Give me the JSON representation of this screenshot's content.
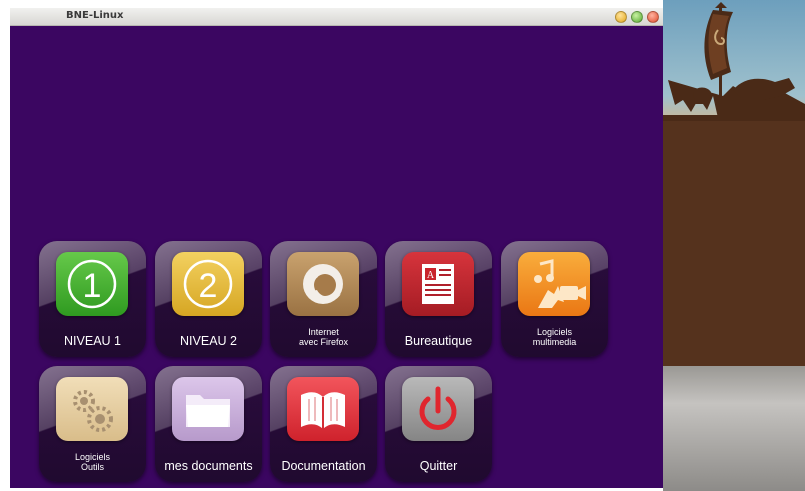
{
  "window": {
    "title": "BNE-Linux"
  },
  "colors": {
    "window_bg": "#3b0661",
    "niveau1": "#3fae2a",
    "niveau2": "#e3b72a",
    "internet": "#b28a58",
    "bureautique": "#b0202a",
    "multimedia": "#f08a20",
    "outils": "#e7cfa2",
    "documents": "#c9b0d9",
    "documentation": "#e8323c",
    "quitter": "#9a9a9a"
  },
  "tiles": [
    {
      "id": "niveau-1",
      "icon": "number-one-icon",
      "label": "NIVEAU 1"
    },
    {
      "id": "niveau-2",
      "icon": "number-two-icon",
      "label": "NIVEAU 2"
    },
    {
      "id": "internet",
      "icon": "firefox-icon",
      "label_line1": "Internet",
      "label_line2": "avec Firefox"
    },
    {
      "id": "bureautique",
      "icon": "document-icon",
      "label": "Bureautique"
    },
    {
      "id": "multimedia",
      "icon": "multimedia-icon",
      "label_line1": "Logiciels",
      "label_line2": "multimedia"
    },
    {
      "id": "outils",
      "icon": "gears-icon",
      "label_line1": "Logiciels",
      "label_line2": "Outils"
    },
    {
      "id": "documents",
      "icon": "folder-icon",
      "label": "mes documents"
    },
    {
      "id": "documentation",
      "icon": "book-icon",
      "label": "Documentation"
    },
    {
      "id": "quitter",
      "icon": "power-icon",
      "label": "Quitter"
    }
  ]
}
